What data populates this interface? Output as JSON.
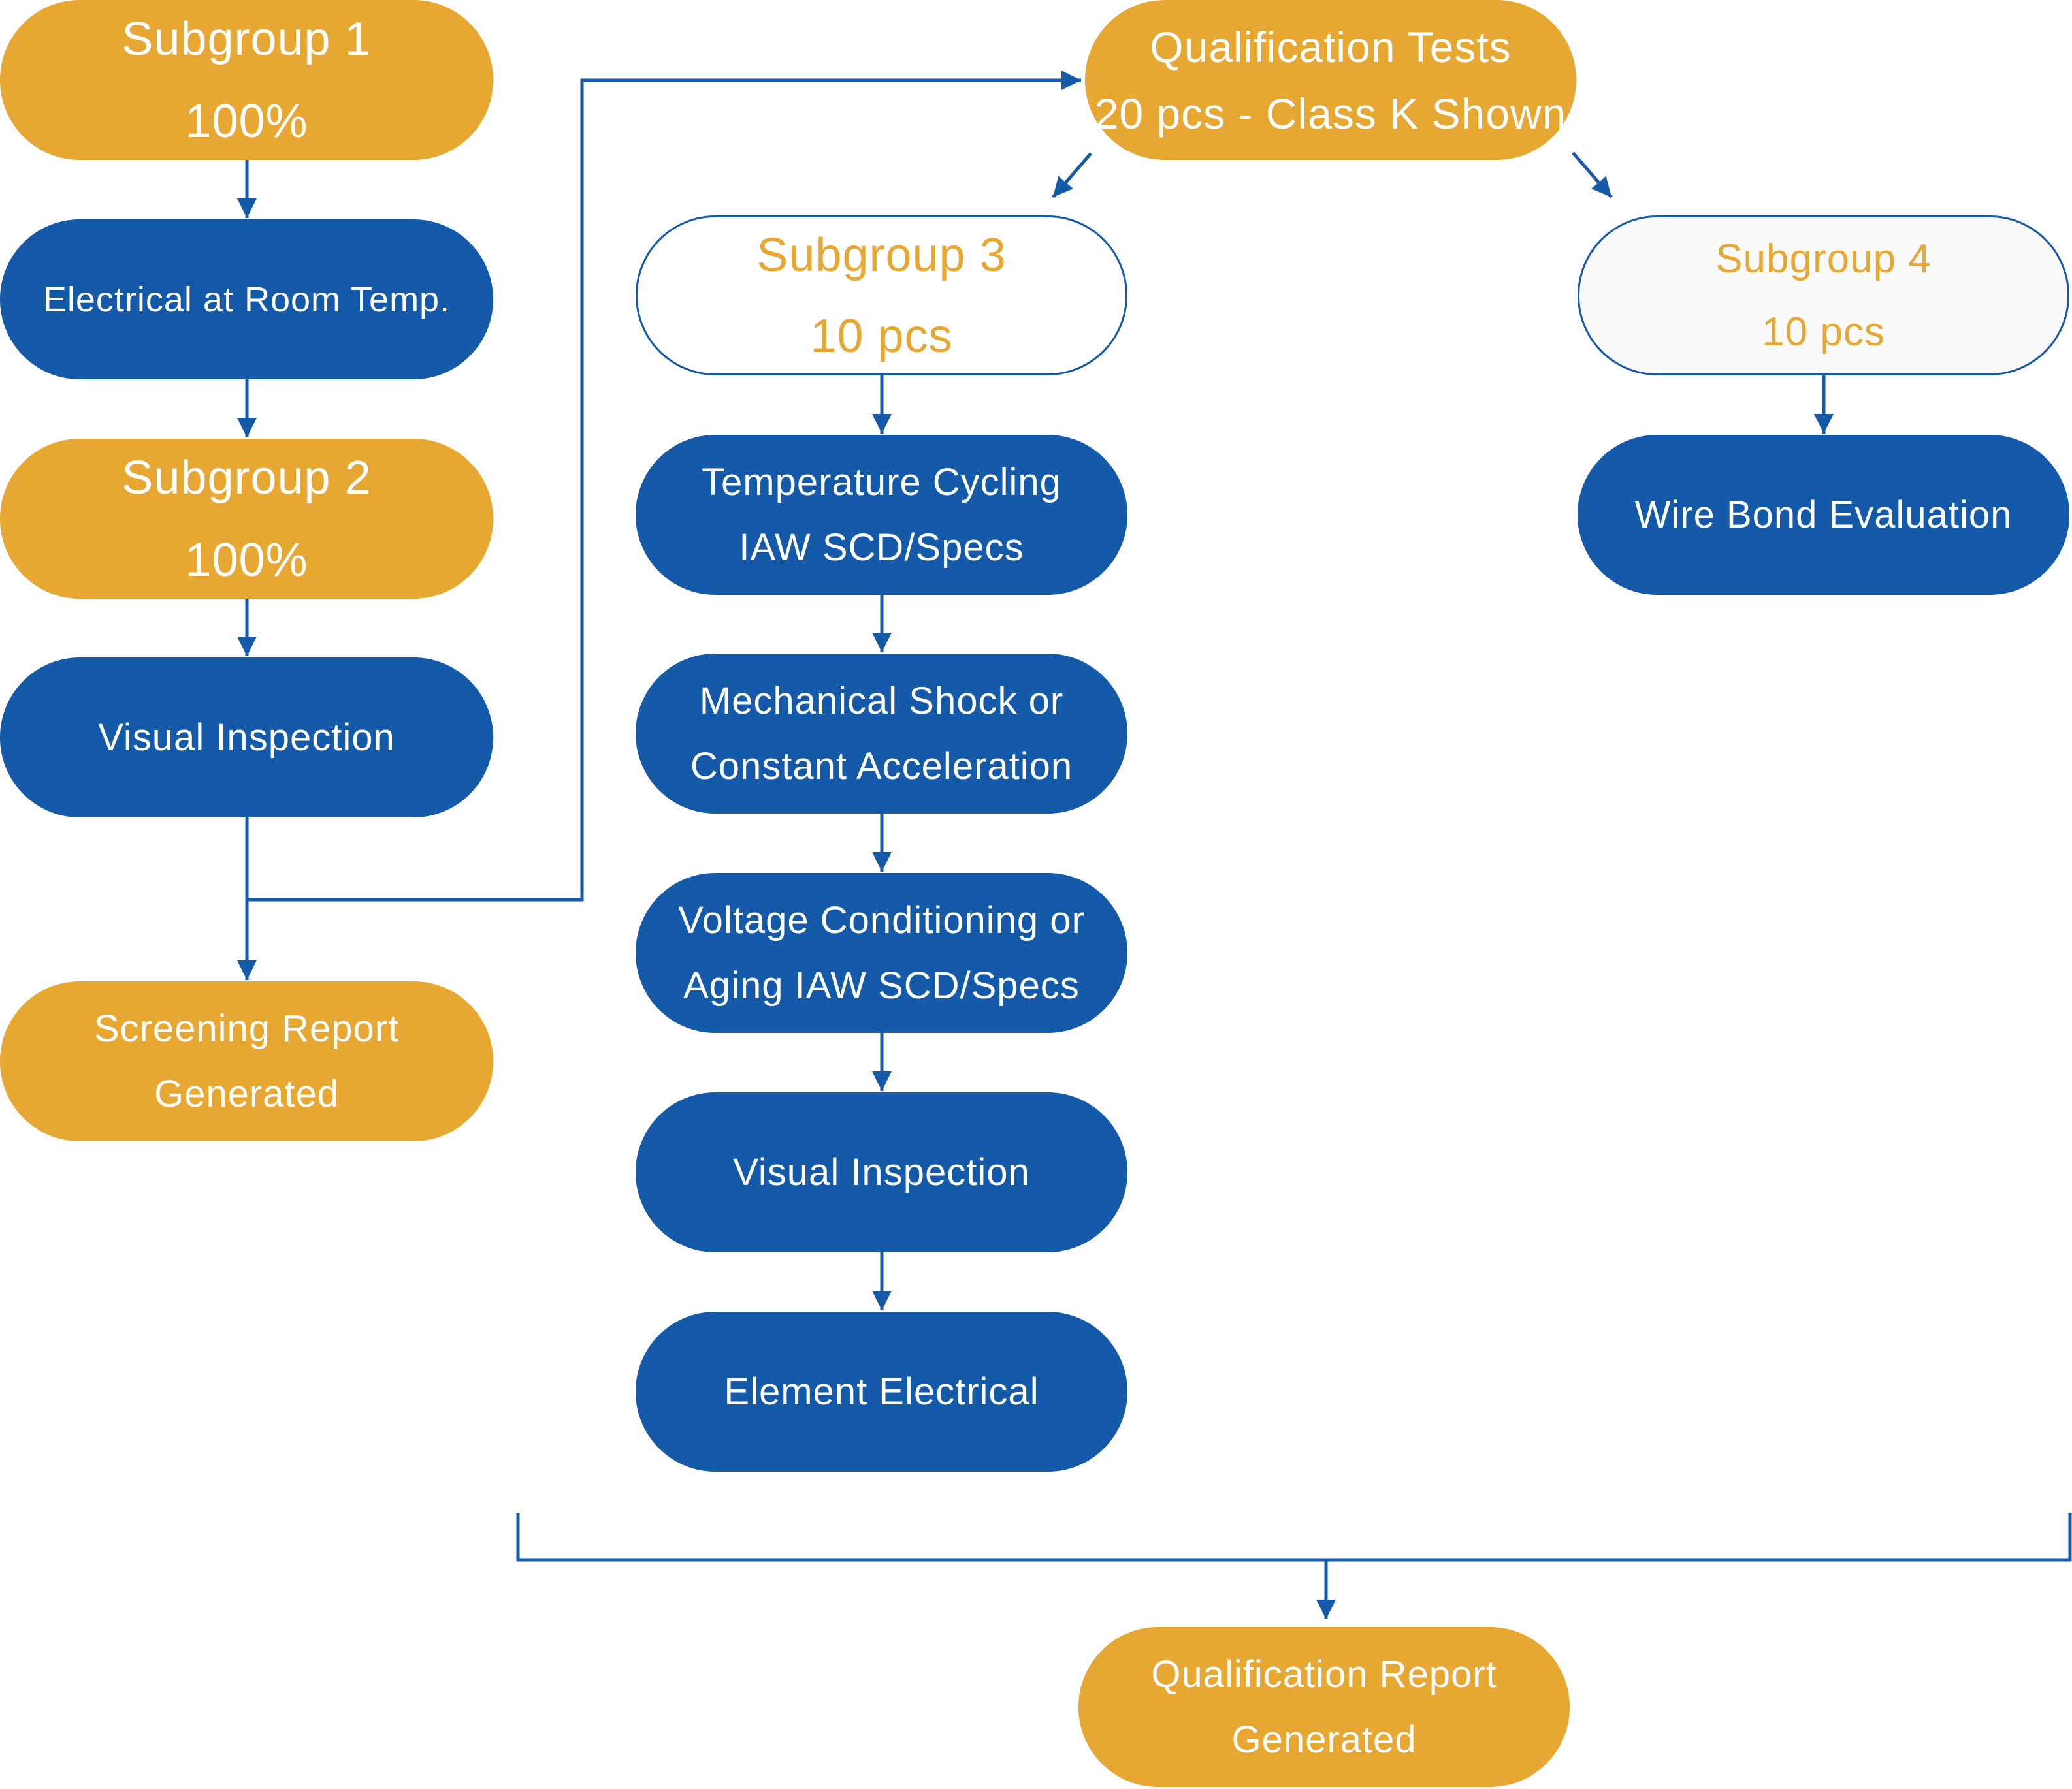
{
  "colors": {
    "gold": "#E6A733",
    "blue": "#155AA8",
    "white": "#FFFFFF",
    "light_gray": "#F9F9F9"
  },
  "screening_flow": {
    "subgroup1": {
      "title": "Subgroup 1",
      "subtitle": "100%"
    },
    "electrical_room_temp": {
      "label": "Electrical at Room Temp."
    },
    "subgroup2": {
      "title": "Subgroup 2",
      "subtitle": "100%"
    },
    "visual_inspection": {
      "label": "Visual Inspection"
    },
    "screening_report": {
      "line1": "Screening Report",
      "line2": "Generated"
    }
  },
  "qualification_tests": {
    "line1": "Qualification Tests",
    "line2": "20 pcs - Class K Shown"
  },
  "subgroup3": {
    "title": "Subgroup 3",
    "subtitle": "10 pcs",
    "steps": [
      {
        "line1": "Temperature Cycling",
        "line2": "IAW SCD/Specs"
      },
      {
        "line1": "Mechanical Shock or",
        "line2": "Constant Acceleration"
      },
      {
        "line1": "Voltage Conditioning or",
        "line2": "Aging IAW SCD/Specs"
      },
      {
        "line1": "Visual Inspection"
      },
      {
        "line1": "Element Electrical"
      }
    ]
  },
  "subgroup4": {
    "title": "Subgroup 4",
    "subtitle": "10 pcs",
    "steps": [
      {
        "line1": "Wire Bond Evaluation"
      }
    ]
  },
  "qualification_report": {
    "line1": "Qualification Report",
    "line2": "Generated"
  }
}
